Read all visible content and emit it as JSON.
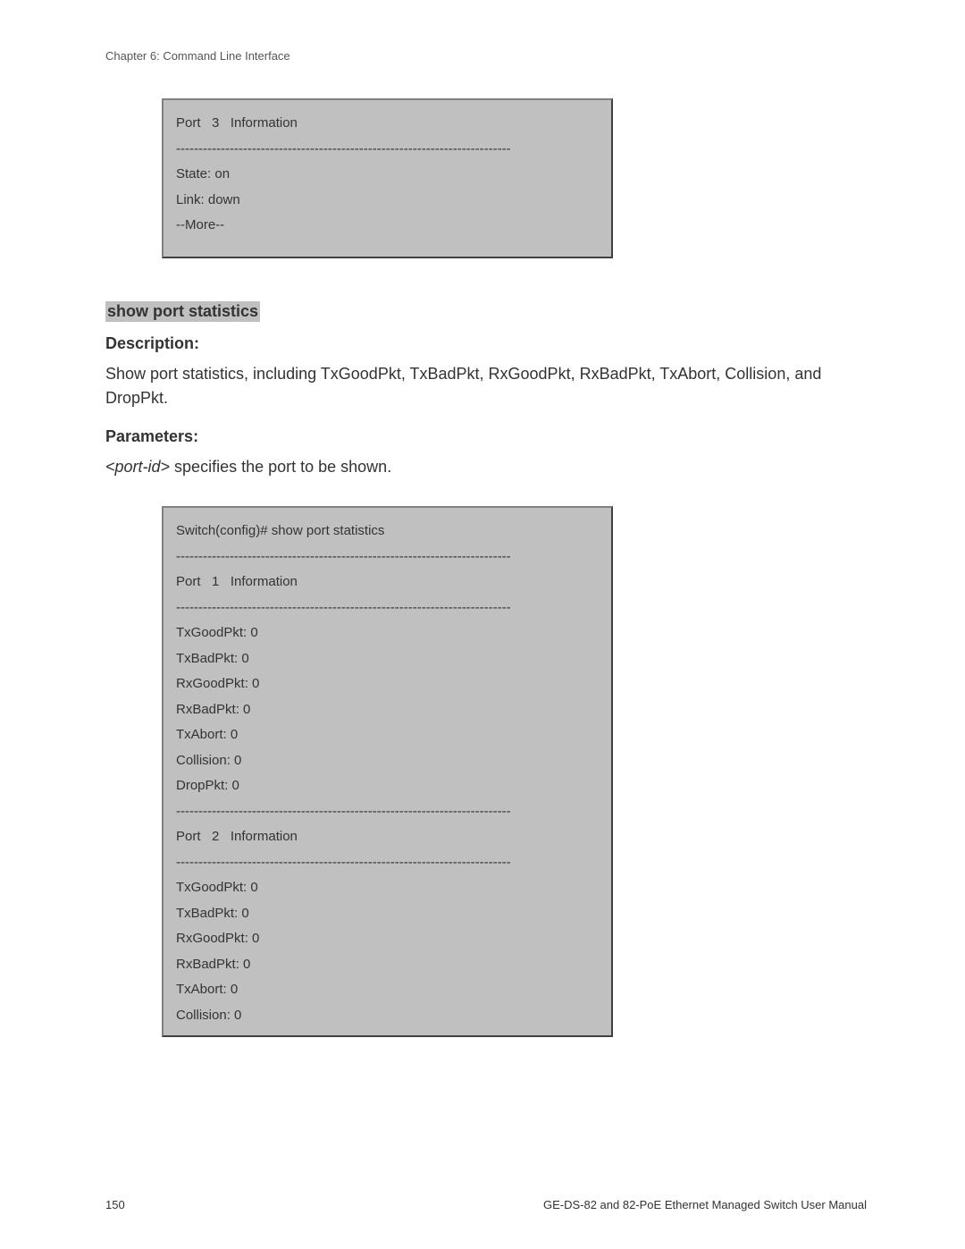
{
  "header": {
    "chapter": "Chapter 6: Command Line Interface"
  },
  "box1": {
    "l1": "Port   3   Information",
    "sep": "---------------------------------------------------------------------------",
    "l2": "State: on",
    "l3": "Link: down",
    "l4": "--More--"
  },
  "section": {
    "heading": "show port statistics",
    "descLabel": "Description:",
    "descText": "Show port statistics, including TxGoodPkt, TxBadPkt, RxGoodPkt, RxBadPkt, TxAbort, Collision, and DropPkt.",
    "paramLabel": "Parameters:",
    "paramItalic": "<port-id>",
    "paramText": " specifies the port to be shown."
  },
  "box2": {
    "cmd": "Switch(config)# show port statistics",
    "sep": "---------------------------------------------------------------------------",
    "p1header": "Port   1   Information",
    "p2header": "Port   2   Information",
    "txgood": "TxGoodPkt: 0",
    "txbad": "TxBadPkt: 0",
    "rxgood": "RxGoodPkt: 0",
    "rxbad": "RxBadPkt: 0",
    "txabort": "TxAbort: 0",
    "collision": "Collision: 0",
    "droppkt": "DropPkt: 0"
  },
  "footer": {
    "pagenum": "150",
    "manual": "GE-DS-82 and 82-PoE Ethernet Managed Switch User Manual"
  }
}
